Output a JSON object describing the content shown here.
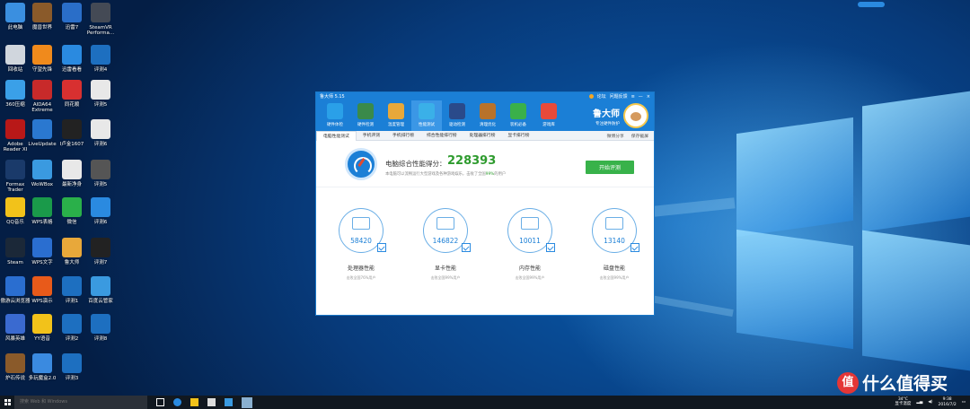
{
  "desktop": {
    "icons": [
      {
        "label": "此电脑",
        "color": "#3a8fe0"
      },
      {
        "label": "魔兽世界",
        "color": "#8a5a2a"
      },
      {
        "label": "迅雷7",
        "color": "#2a6ec8"
      },
      {
        "label": "SteamVR Performa...",
        "color": "#444a55"
      },
      {
        "label": "回收站",
        "color": "#d0d6dd"
      },
      {
        "label": "守望先锋",
        "color": "#f08a1c"
      },
      {
        "label": "迅雷看看",
        "color": "#2a8ae0"
      },
      {
        "label": "评测4",
        "color": "#1d6fc0"
      },
      {
        "label": "360压缩",
        "color": "#3aa0e8"
      },
      {
        "label": "AIDA64 Extreme",
        "color": "#c82a2a"
      },
      {
        "label": "同花顺",
        "color": "#d83030"
      },
      {
        "label": "评测5",
        "color": "#e8e8e8"
      },
      {
        "label": "Adobe Reader XI",
        "color": "#b81818"
      },
      {
        "label": "LiveUpdate",
        "color": "#2a78d0"
      },
      {
        "label": "Ⅰ卢金1607",
        "color": "#222222"
      },
      {
        "label": "评测6",
        "color": "#e8e8e8"
      },
      {
        "label": "Formax Trader",
        "color": "#1a3a6a"
      },
      {
        "label": "WoWBox",
        "color": "#3a9ae0"
      },
      {
        "label": "最新净身",
        "color": "#e8e8e8"
      },
      {
        "label": "评测5",
        "color": "#555555"
      },
      {
        "label": "QQ音乐",
        "color": "#f2c21a"
      },
      {
        "label": "WPS表格",
        "color": "#1a9a4a"
      },
      {
        "label": "微信",
        "color": "#2ab04a"
      },
      {
        "label": "评测6",
        "color": "#2a8ae0"
      },
      {
        "label": "Steam",
        "color": "#1b2838"
      },
      {
        "label": "WPS文字",
        "color": "#2a6ed0"
      },
      {
        "label": "鲁大师",
        "color": "#e8a83a"
      },
      {
        "label": "评测7",
        "color": "#222222"
      },
      {
        "label": "傲游云浏览器",
        "color": "#2a6ed0"
      },
      {
        "label": "WPS演示",
        "color": "#e85a1a"
      },
      {
        "label": "评测1",
        "color": "#1d6fc0"
      },
      {
        "label": "百度云管家",
        "color": "#3a9ae0"
      },
      {
        "label": "风暴英雄",
        "color": "#3a6ad0"
      },
      {
        "label": "YY语音",
        "color": "#f2c21a"
      },
      {
        "label": "评测2",
        "color": "#1d6fc0"
      },
      {
        "label": "评测8",
        "color": "#1d6fc0"
      },
      {
        "label": "炉石传说",
        "color": "#8a5a2a"
      },
      {
        "label": "多玩魔盒2.0",
        "color": "#3a8ae0"
      },
      {
        "label": "评测3",
        "color": "#1d6fc0"
      }
    ]
  },
  "window": {
    "title": "鲁大师 5.15",
    "title_links": [
      "论坛",
      "问题反馈"
    ],
    "toolbar": [
      {
        "label": "硬件体检",
        "color": "#2aa0e8"
      },
      {
        "label": "硬件检测",
        "color": "#3a8a4a"
      },
      {
        "label": "温度管理",
        "color": "#e8a83a"
      },
      {
        "label": "性能测试",
        "color": "#3ab0e8",
        "active": true
      },
      {
        "label": "驱动检测",
        "color": "#2a4a8a"
      },
      {
        "label": "清理优化",
        "color": "#b8722a"
      },
      {
        "label": "装机必备",
        "color": "#3ab04a"
      },
      {
        "label": "游戏库",
        "color": "#e84a3a"
      }
    ],
    "brand_name": "鲁大师",
    "brand_slogan": "专注硬件防护",
    "tabs": [
      "电脑性能测试",
      "手机评测",
      "手机排行榜",
      "综合性能排行榜",
      "处理器排行榜",
      "显卡排行榜"
    ],
    "tab_actions": [
      "微博分享",
      "保存截屏"
    ],
    "score": {
      "label": "电脑综合性能得分：",
      "value": "228393",
      "desc_prefix": "本电脑可以流畅运行大型游戏及各种游戏娱乐，击败了全国",
      "desc_pct": "99%",
      "desc_suffix": "的用户"
    },
    "start_button": "开始评测",
    "cards": [
      {
        "value": "58420",
        "name": "处理器性能",
        "sub": "击败全国76%用户"
      },
      {
        "value": "146822",
        "name": "显卡性能",
        "sub": "击败全国99%用户"
      },
      {
        "value": "10011",
        "name": "内存性能",
        "sub": "击败全国99%用户"
      },
      {
        "value": "13140",
        "name": "磁盘性能",
        "sub": "击败全国99%用户"
      }
    ]
  },
  "taskbar": {
    "search_placeholder": "搜索 Web 和 Windows",
    "temp": "34°C",
    "temp_label": "显卡温度",
    "time": "9:38",
    "date": "2016/7/2"
  },
  "watermark": {
    "icon_text": "值",
    "text": "什么值得买"
  }
}
